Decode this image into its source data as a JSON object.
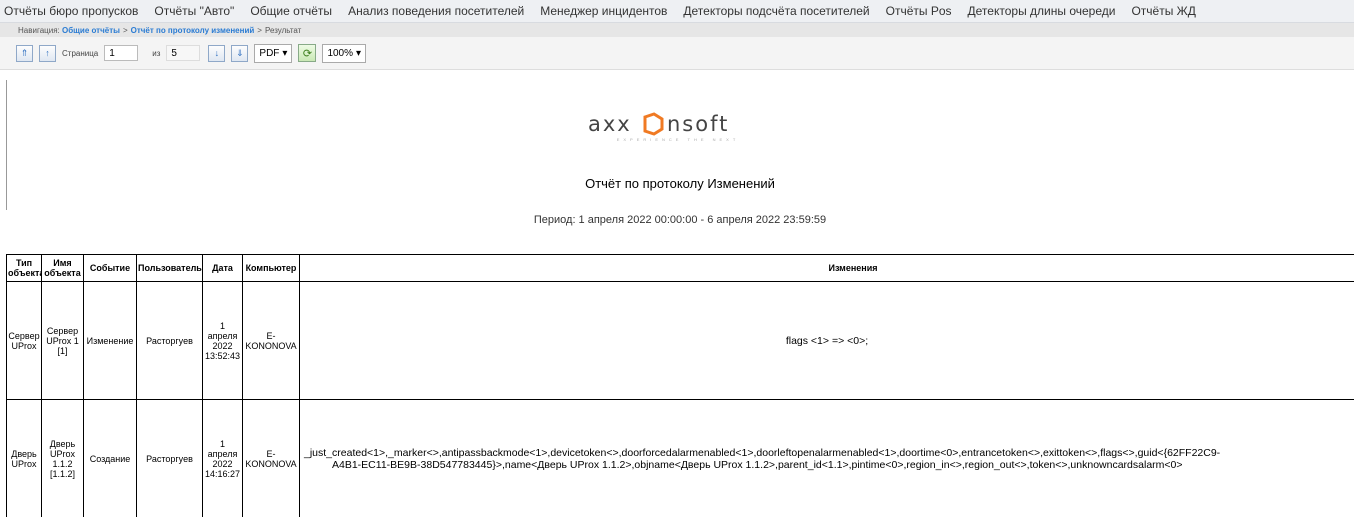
{
  "top_menu": [
    "Отчёты бюро пропусков",
    "Отчёты \"Авто\"",
    "Общие отчёты",
    "Анализ поведения посетителей",
    "Менеджер инцидентов",
    "Детекторы подсчёта посетителей",
    "Отчёты Pos",
    "Детекторы длины очереди",
    "Отчёты ЖД"
  ],
  "nav": {
    "label": "Навигация:",
    "crumb1": "Общие отчёты",
    "sep": ">",
    "crumb2": "Отчёт по протоколу изменений",
    "current": "Результат"
  },
  "toolbar": {
    "page_label": "Страница",
    "page_value": "1",
    "of_label": "из",
    "total_pages": "5",
    "format": "PDF",
    "zoom": "100%"
  },
  "report": {
    "logo": {
      "brand": "AXXONSOFT",
      "tagline": "EXPERIENCE THE NEXT"
    },
    "title": "Отчёт по протоколу Изменений",
    "period": "Период: 1 апреля 2022 00:00:00 - 6 апреля 2022 23:59:59"
  },
  "table": {
    "headers": [
      "Тип объекта",
      "Имя объекта",
      "Событие",
      "Пользователь",
      "Дата",
      "Компьютер",
      "Изменения"
    ],
    "rows": [
      {
        "type": "Сервер UProx",
        "name": "Сервер UProx 1 [1]",
        "event": "Изменение",
        "user": "Расторгуев",
        "date": "1 апреля 2022 13:52:43",
        "computer": "E-KONONOVA",
        "changes_line1": "flags <1> => <0>;",
        "changes_line2": ""
      },
      {
        "type": "Дверь UProx",
        "name": "Дверь UProx 1.1.2 [1.1.2]",
        "event": "Создание",
        "user": "Расторгуев",
        "date": "1 апреля 2022 14:16:27",
        "computer": "E-KONONOVA",
        "changes_line1": "_just_created<1>,_marker<>,antipassbackmode<1>,devicetoken<>,doorforcedalarmenabled<1>,doorleftopenalarmenabled<1>,doortime<0>,entrancetoken<>,exittoken<>,flags<>,guid<{62FF22C9-",
        "changes_line2": "A4B1-EC11-BE9B-38D547783445}>,name<Дверь UProx 1.1.2>,objname<Дверь UProx 1.1.2>,parent_id<1.1>,pintime<0>,region_in<>,region_out<>,token<>,unknowncardsalarm<0>"
      }
    ]
  }
}
